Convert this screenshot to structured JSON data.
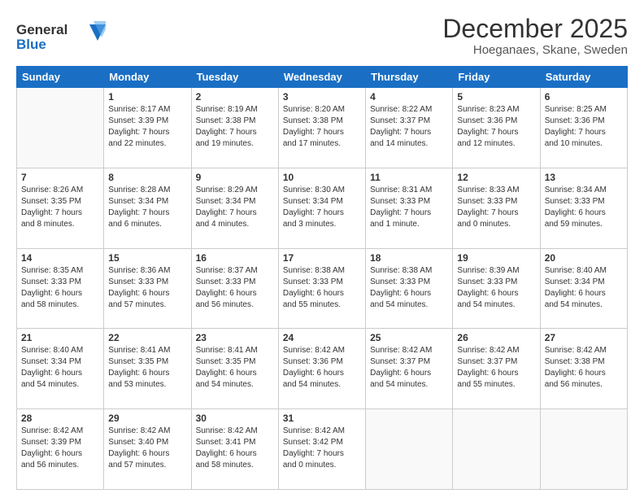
{
  "logo": {
    "line1": "General",
    "line2": "Blue"
  },
  "title": "December 2025",
  "subtitle": "Hoeganaes, Skane, Sweden",
  "weekdays": [
    "Sunday",
    "Monday",
    "Tuesday",
    "Wednesday",
    "Thursday",
    "Friday",
    "Saturday"
  ],
  "weeks": [
    [
      {
        "day": "",
        "info": ""
      },
      {
        "day": "1",
        "info": "Sunrise: 8:17 AM\nSunset: 3:39 PM\nDaylight: 7 hours\nand 22 minutes."
      },
      {
        "day": "2",
        "info": "Sunrise: 8:19 AM\nSunset: 3:38 PM\nDaylight: 7 hours\nand 19 minutes."
      },
      {
        "day": "3",
        "info": "Sunrise: 8:20 AM\nSunset: 3:38 PM\nDaylight: 7 hours\nand 17 minutes."
      },
      {
        "day": "4",
        "info": "Sunrise: 8:22 AM\nSunset: 3:37 PM\nDaylight: 7 hours\nand 14 minutes."
      },
      {
        "day": "5",
        "info": "Sunrise: 8:23 AM\nSunset: 3:36 PM\nDaylight: 7 hours\nand 12 minutes."
      },
      {
        "day": "6",
        "info": "Sunrise: 8:25 AM\nSunset: 3:36 PM\nDaylight: 7 hours\nand 10 minutes."
      }
    ],
    [
      {
        "day": "7",
        "info": "Sunrise: 8:26 AM\nSunset: 3:35 PM\nDaylight: 7 hours\nand 8 minutes."
      },
      {
        "day": "8",
        "info": "Sunrise: 8:28 AM\nSunset: 3:34 PM\nDaylight: 7 hours\nand 6 minutes."
      },
      {
        "day": "9",
        "info": "Sunrise: 8:29 AM\nSunset: 3:34 PM\nDaylight: 7 hours\nand 4 minutes."
      },
      {
        "day": "10",
        "info": "Sunrise: 8:30 AM\nSunset: 3:34 PM\nDaylight: 7 hours\nand 3 minutes."
      },
      {
        "day": "11",
        "info": "Sunrise: 8:31 AM\nSunset: 3:33 PM\nDaylight: 7 hours\nand 1 minute."
      },
      {
        "day": "12",
        "info": "Sunrise: 8:33 AM\nSunset: 3:33 PM\nDaylight: 7 hours\nand 0 minutes."
      },
      {
        "day": "13",
        "info": "Sunrise: 8:34 AM\nSunset: 3:33 PM\nDaylight: 6 hours\nand 59 minutes."
      }
    ],
    [
      {
        "day": "14",
        "info": "Sunrise: 8:35 AM\nSunset: 3:33 PM\nDaylight: 6 hours\nand 58 minutes."
      },
      {
        "day": "15",
        "info": "Sunrise: 8:36 AM\nSunset: 3:33 PM\nDaylight: 6 hours\nand 57 minutes."
      },
      {
        "day": "16",
        "info": "Sunrise: 8:37 AM\nSunset: 3:33 PM\nDaylight: 6 hours\nand 56 minutes."
      },
      {
        "day": "17",
        "info": "Sunrise: 8:38 AM\nSunset: 3:33 PM\nDaylight: 6 hours\nand 55 minutes."
      },
      {
        "day": "18",
        "info": "Sunrise: 8:38 AM\nSunset: 3:33 PM\nDaylight: 6 hours\nand 54 minutes."
      },
      {
        "day": "19",
        "info": "Sunrise: 8:39 AM\nSunset: 3:33 PM\nDaylight: 6 hours\nand 54 minutes."
      },
      {
        "day": "20",
        "info": "Sunrise: 8:40 AM\nSunset: 3:34 PM\nDaylight: 6 hours\nand 54 minutes."
      }
    ],
    [
      {
        "day": "21",
        "info": "Sunrise: 8:40 AM\nSunset: 3:34 PM\nDaylight: 6 hours\nand 54 minutes."
      },
      {
        "day": "22",
        "info": "Sunrise: 8:41 AM\nSunset: 3:35 PM\nDaylight: 6 hours\nand 53 minutes."
      },
      {
        "day": "23",
        "info": "Sunrise: 8:41 AM\nSunset: 3:35 PM\nDaylight: 6 hours\nand 54 minutes."
      },
      {
        "day": "24",
        "info": "Sunrise: 8:42 AM\nSunset: 3:36 PM\nDaylight: 6 hours\nand 54 minutes."
      },
      {
        "day": "25",
        "info": "Sunrise: 8:42 AM\nSunset: 3:37 PM\nDaylight: 6 hours\nand 54 minutes."
      },
      {
        "day": "26",
        "info": "Sunrise: 8:42 AM\nSunset: 3:37 PM\nDaylight: 6 hours\nand 55 minutes."
      },
      {
        "day": "27",
        "info": "Sunrise: 8:42 AM\nSunset: 3:38 PM\nDaylight: 6 hours\nand 56 minutes."
      }
    ],
    [
      {
        "day": "28",
        "info": "Sunrise: 8:42 AM\nSunset: 3:39 PM\nDaylight: 6 hours\nand 56 minutes."
      },
      {
        "day": "29",
        "info": "Sunrise: 8:42 AM\nSunset: 3:40 PM\nDaylight: 6 hours\nand 57 minutes."
      },
      {
        "day": "30",
        "info": "Sunrise: 8:42 AM\nSunset: 3:41 PM\nDaylight: 6 hours\nand 58 minutes."
      },
      {
        "day": "31",
        "info": "Sunrise: 8:42 AM\nSunset: 3:42 PM\nDaylight: 7 hours\nand 0 minutes."
      },
      {
        "day": "",
        "info": ""
      },
      {
        "day": "",
        "info": ""
      },
      {
        "day": "",
        "info": ""
      }
    ]
  ]
}
